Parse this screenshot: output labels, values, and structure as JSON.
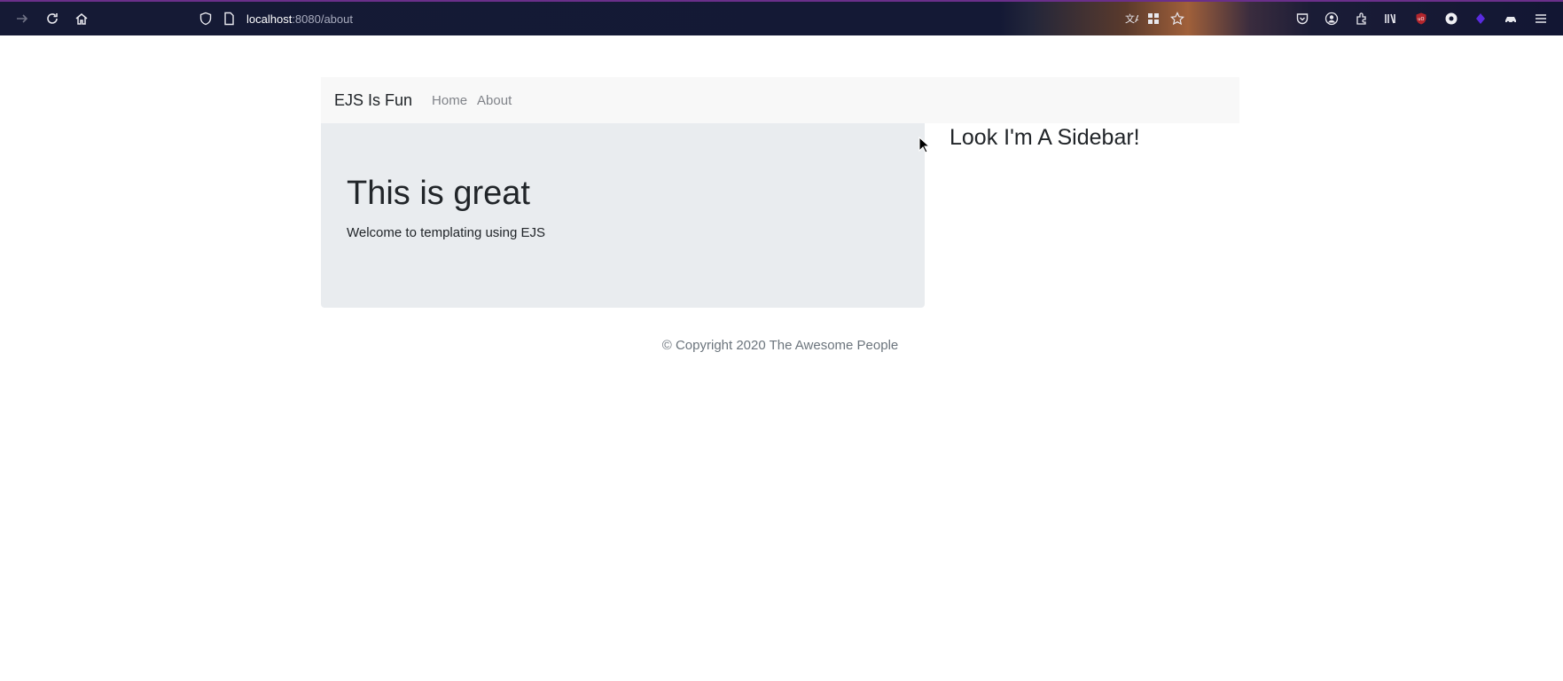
{
  "browser": {
    "url_host": "localhost",
    "url_rest": ":8080/about",
    "icons": [
      "forward-icon",
      "reload-icon",
      "home-icon",
      "shield-icon",
      "page-icon",
      "translate-icon",
      "grid-icon",
      "star-icon",
      "pocket-icon",
      "account-icon",
      "extensions-icon",
      "library-icon",
      "ublock-icon",
      "extension-circle-icon",
      "extension-gem-icon",
      "extension-car-icon",
      "menu-icon"
    ]
  },
  "navbar": {
    "brand": "EJS Is Fun",
    "links": [
      {
        "label": "Home"
      },
      {
        "label": "About"
      }
    ]
  },
  "jumbotron": {
    "title": "This is great",
    "text": "Welcome to templating using EJS"
  },
  "sidebar": {
    "title": "Look I'm A Sidebar!"
  },
  "footer": {
    "text": "© Copyright 2020 The Awesome People"
  },
  "colors": {
    "navbar_bg": "#f8f8f8",
    "jumbotron_bg": "#e9ecef",
    "toolbar_bg": "#151a35"
  }
}
